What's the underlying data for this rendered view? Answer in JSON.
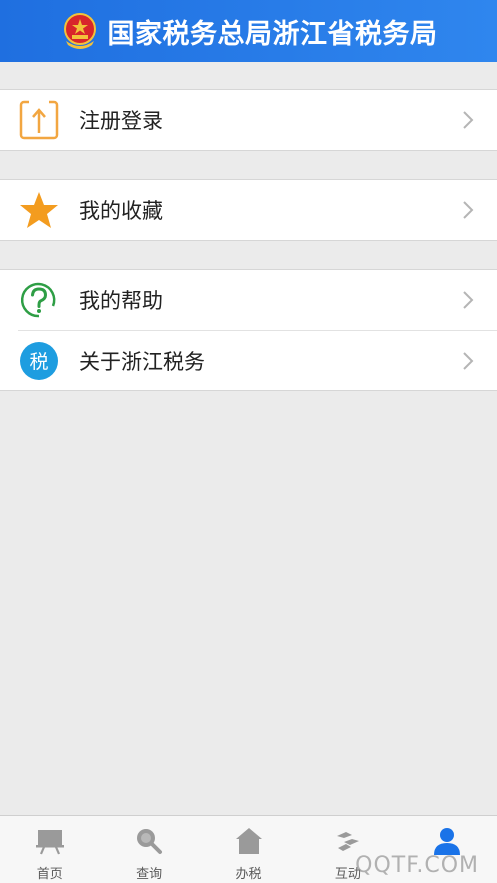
{
  "header": {
    "title": "国家税务总局浙江省税务局",
    "emblem_icon": "national-emblem-icon"
  },
  "groups": [
    {
      "items": [
        {
          "label": "注册登录",
          "icon": "login-upload-icon"
        }
      ]
    },
    {
      "items": [
        {
          "label": "我的收藏",
          "icon": "star-icon"
        }
      ]
    },
    {
      "items": [
        {
          "label": "我的帮助",
          "icon": "help-question-icon"
        },
        {
          "label": "关于浙江税务",
          "icon": "tax-badge-icon",
          "badge_text": "税"
        }
      ]
    }
  ],
  "tabbar": {
    "tabs": [
      {
        "label": "首页",
        "icon": "billboard-icon",
        "active": false
      },
      {
        "label": "查询",
        "icon": "search-icon",
        "active": false
      },
      {
        "label": "办税",
        "icon": "home-icon",
        "active": false
      },
      {
        "label": "互动",
        "icon": "handshake-icon",
        "active": false
      },
      {
        "label": "",
        "icon": "user-icon",
        "active": true
      }
    ]
  },
  "watermark": "QQTF.COM",
  "colors": {
    "header_start": "#1f6fe0",
    "header_end": "#2f86ee",
    "accent": "#1a73e8",
    "login_orange": "#f2a641",
    "star_orange": "#f39c1f",
    "help_green": "#2e9e45",
    "tax_blue": "#1e9de0"
  }
}
